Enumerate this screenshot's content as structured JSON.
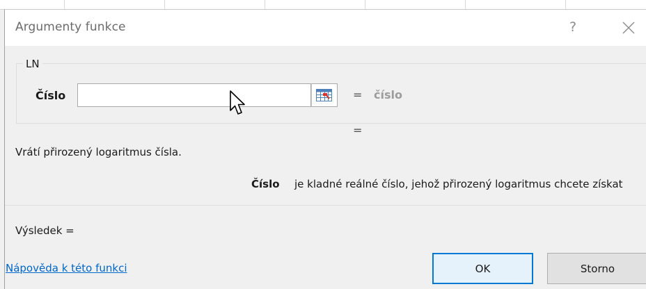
{
  "dialog": {
    "title": "Argumenty funkce",
    "help_glyph": "?",
    "close_icon": "close-icon"
  },
  "function_group": {
    "name": "LN",
    "arguments": [
      {
        "label": "Číslo",
        "value": "",
        "equals": "=",
        "evaluated": "číslo"
      }
    ],
    "result_equals": "="
  },
  "description": "Vrátí přirozený logaritmus čísla.",
  "argument_help": {
    "name": "Číslo",
    "text": "je kladné reálné číslo, jehož přirozený logaritmus chcete získat"
  },
  "result_label": "Výsledek =",
  "help_link": "Nápověda k této funkci",
  "buttons": {
    "ok": "OK",
    "cancel": "Storno"
  },
  "colors": {
    "accent": "#0078d7",
    "link": "#0066cc",
    "evaluated_text": "#9c9c9c"
  }
}
